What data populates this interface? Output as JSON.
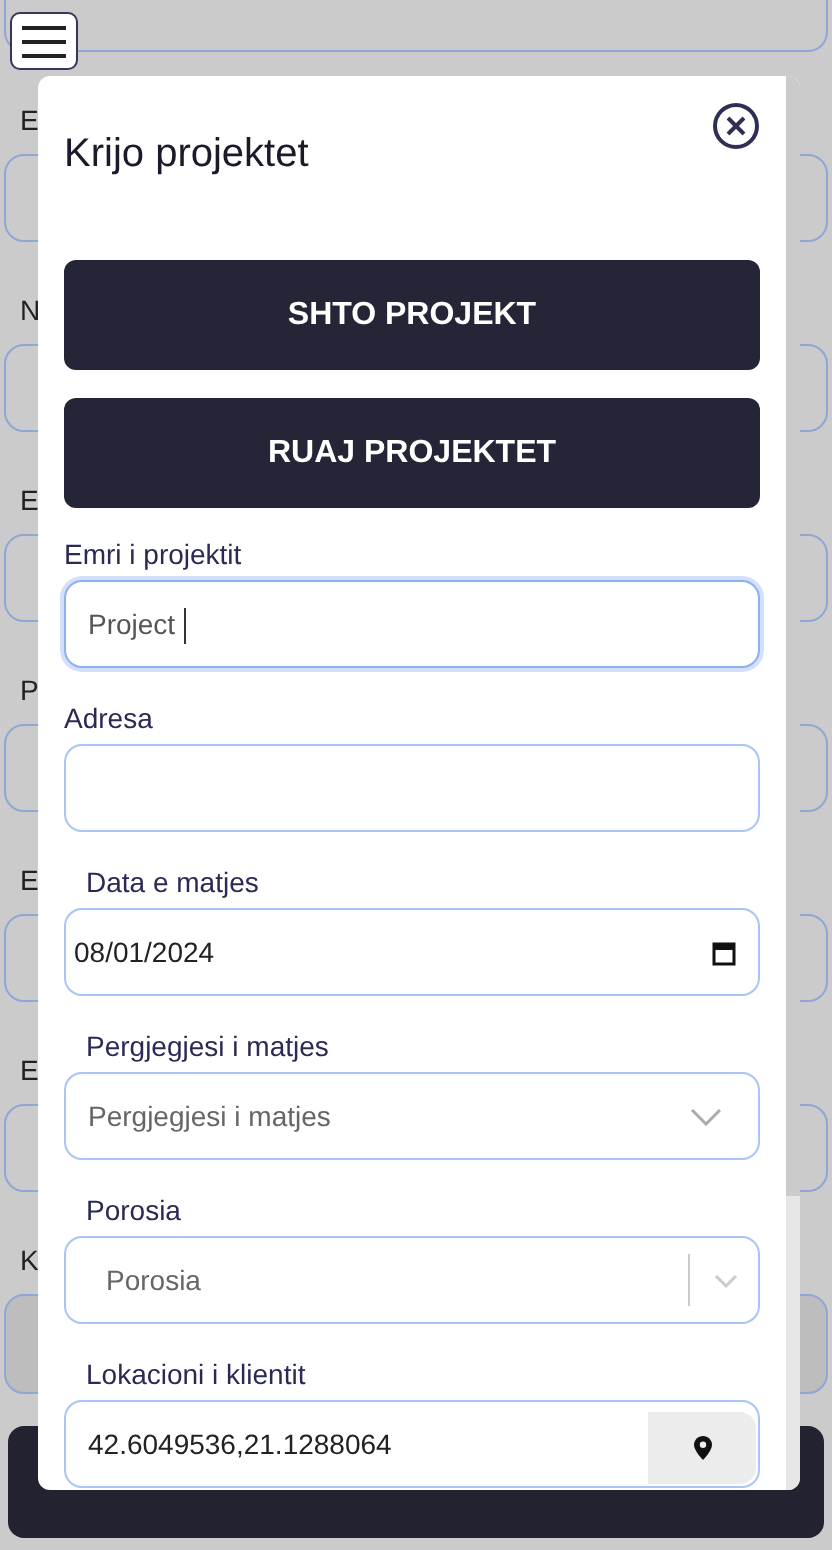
{
  "background": {
    "labels": [
      "E",
      "N",
      "E",
      "P",
      "E",
      "E",
      "K"
    ]
  },
  "modal": {
    "title": "Krijo projektet",
    "buttons": [
      "SHTO PROJEKT",
      "RUAJ PROJEKTET"
    ],
    "fields": [
      {
        "kind": "text",
        "label": "Emri i projektit",
        "value": "Project",
        "focused": true
      },
      {
        "kind": "text",
        "label": "Adresa",
        "focused": false
      },
      {
        "kind": "date",
        "label": "Data e matjes",
        "value": "08/01/2024",
        "focused": false
      },
      {
        "kind": "select",
        "label": "Pergjegjesi i matjes",
        "placeholder": "Pergjegjesi i matjes",
        "focused": false
      },
      {
        "kind": "combo",
        "label": "Porosia",
        "placeholder": "Porosia",
        "focused": false
      },
      {
        "kind": "location",
        "label": "Lokacioni i klientit",
        "value": "42.6049536,21.1288064",
        "focused": false
      }
    ]
  }
}
